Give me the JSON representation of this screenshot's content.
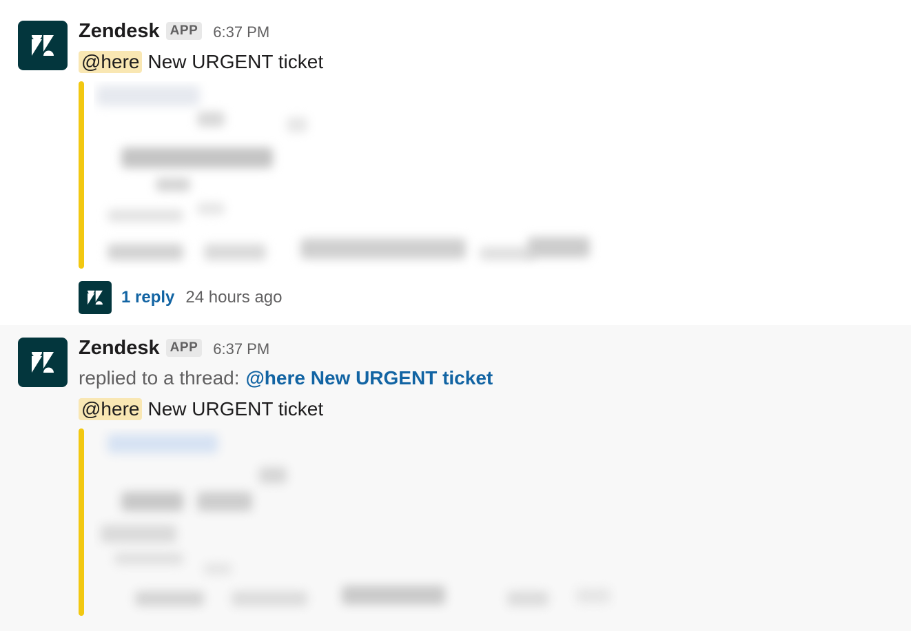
{
  "messages": [
    {
      "sender": "Zendesk",
      "badge": "APP",
      "time": "6:37 PM",
      "mention": "@here",
      "text": "New URGENT ticket",
      "thread": {
        "reply_count": "1 reply",
        "last_reply": "24 hours ago"
      }
    },
    {
      "sender": "Zendesk",
      "badge": "APP",
      "time": "6:37 PM",
      "replied_prefix": "replied to a thread:",
      "replied_link": "@here New URGENT ticket",
      "mention": "@here",
      "text": "New URGENT ticket"
    }
  ],
  "colors": {
    "attachment_bar": "#f2c811",
    "avatar_bg": "#03363d",
    "link": "#1264a3",
    "mention_bg": "#f9e7b3"
  },
  "icons": {
    "avatar": "zendesk-logo-icon"
  }
}
